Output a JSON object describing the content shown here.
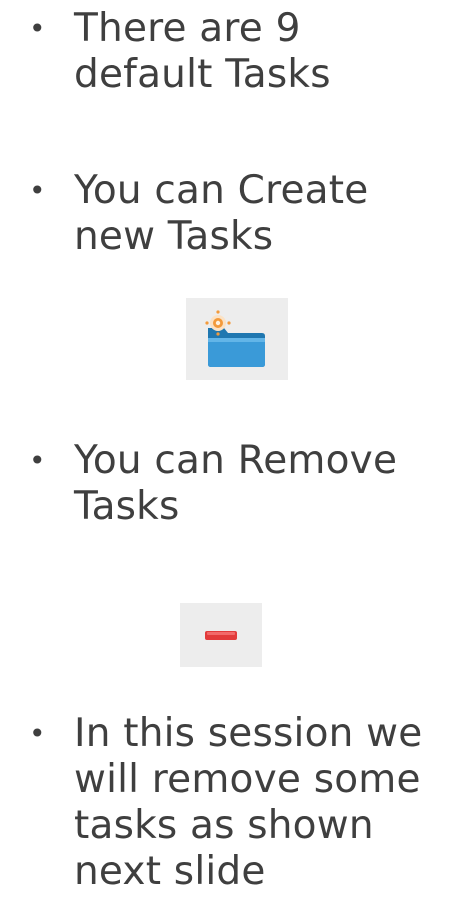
{
  "bullets": [
    {
      "marker": "•",
      "lines": [
        "There are 9",
        "default Tasks"
      ]
    },
    {
      "marker": "•",
      "lines": [
        "You can Create",
        "new Tasks"
      ]
    },
    {
      "marker": "•",
      "lines": [
        "You can Remove",
        "Tasks"
      ]
    },
    {
      "marker": "•",
      "lines": [
        "In this session we",
        "will remove some",
        "tasks as shown",
        "next slide"
      ]
    }
  ],
  "icons": {
    "create": "new-task-folder-icon",
    "remove": "remove-minus-icon"
  },
  "colors": {
    "text": "#3f3f3f",
    "icon_background": "#ededed",
    "folder_blue": "#2d8fc8",
    "minus_red": "#e23b3b",
    "sparkle_orange": "#f39a3b"
  }
}
